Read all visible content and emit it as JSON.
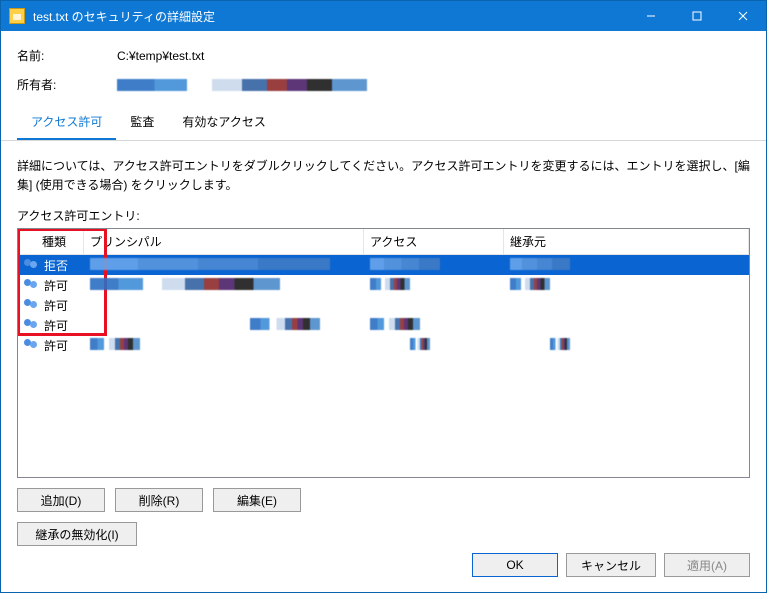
{
  "titlebar": {
    "title": "test.txt のセキュリティの詳細設定"
  },
  "header": {
    "name_label": "名前:",
    "name_value": "C:¥temp¥test.txt",
    "owner_label": "所有者:"
  },
  "tabs": {
    "permissions": "アクセス許可",
    "auditing": "監査",
    "effective": "有効なアクセス"
  },
  "help_text": "詳細については、アクセス許可エントリをダブルクリックしてください。アクセス許可エントリを変更するには、エントリを選択し、[編集] (使用できる場合) をクリックします。",
  "entries_label": "アクセス許可エントリ:",
  "columns": {
    "type": "種類",
    "principal": "プリンシパル",
    "access": "アクセス",
    "inherited": "継承元"
  },
  "entries": [
    {
      "type": "拒否",
      "selected": true
    },
    {
      "type": "許可",
      "selected": false
    },
    {
      "type": "許可",
      "selected": false
    },
    {
      "type": "許可",
      "selected": false
    },
    {
      "type": "許可",
      "selected": false
    }
  ],
  "buttons": {
    "add": "追加(D)",
    "remove": "削除(R)",
    "edit": "編集(E)",
    "disable_inherit": "継承の無効化(I)",
    "ok": "OK",
    "cancel": "キャンセル",
    "apply": "適用(A)"
  }
}
